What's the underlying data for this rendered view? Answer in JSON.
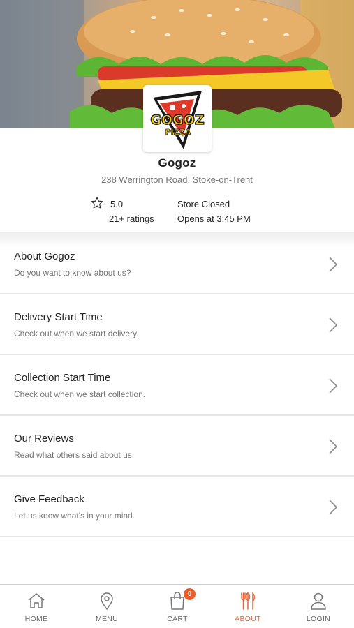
{
  "restaurant": {
    "logo_text": "GOGOZ",
    "logo_subtext": "PIZZA",
    "name": "Gogoz",
    "address": "238 Werrington Road, Stoke-on-Trent",
    "rating": "5.0",
    "rating_count": "21+ ratings",
    "store_status": "Store Closed",
    "opens_at": "Opens at 3:45 PM"
  },
  "menu": [
    {
      "title": "About Gogoz",
      "subtitle": "Do you want to know about us?"
    },
    {
      "title": "Delivery Start Time",
      "subtitle": "Check out when we start delivery."
    },
    {
      "title": "Collection Start Time",
      "subtitle": "Check out when we start collection."
    },
    {
      "title": "Our Reviews",
      "subtitle": "Read what others said about us."
    },
    {
      "title": "Give Feedback",
      "subtitle": "Let us know what's in your mind."
    }
  ],
  "bottom_nav": {
    "items": [
      {
        "label": "HOME",
        "icon": "home-icon"
      },
      {
        "label": "MENU",
        "icon": "location-pin-icon"
      },
      {
        "label": "CART",
        "icon": "shopping-bag-icon",
        "badge": "0"
      },
      {
        "label": "ABOUT",
        "icon": "cutlery-icon"
      },
      {
        "label": "LOGIN",
        "icon": "user-icon"
      }
    ],
    "active": "ABOUT",
    "accent_color": "#e8623a"
  }
}
